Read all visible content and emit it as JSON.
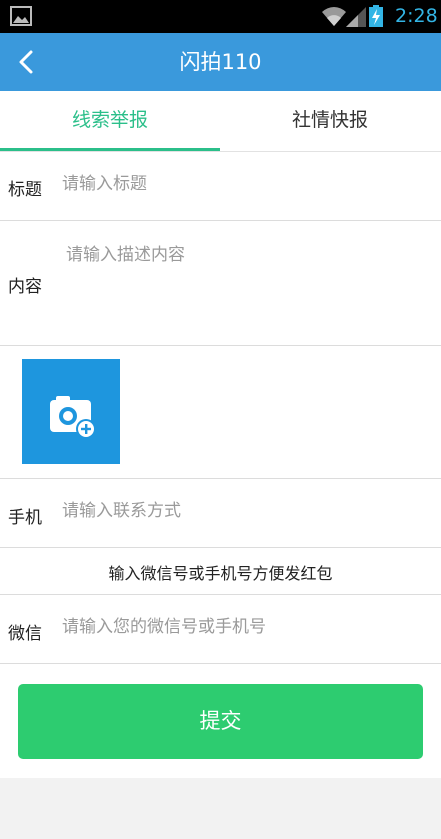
{
  "status_bar": {
    "time": "2:28"
  },
  "header": {
    "title": "闪拍110"
  },
  "tabs": [
    {
      "label": "线索举报"
    },
    {
      "label": "社情快报"
    }
  ],
  "form": {
    "title": {
      "label": "标题",
      "placeholder": "请输入标题"
    },
    "content": {
      "label": "内容",
      "placeholder": "请输入描述内容"
    },
    "phone": {
      "label": "手机",
      "placeholder": "请输入联系方式"
    },
    "notice": "输入微信号或手机号方便发红包",
    "wechat": {
      "label": "微信",
      "placeholder": "请输入您的微信号或手机号"
    },
    "submit_label": "提交"
  },
  "colors": {
    "title_bar": "#3a99dc",
    "accent_green": "#2bbf8a",
    "submit_green": "#2dcc70",
    "photo_button": "#1e96de"
  }
}
